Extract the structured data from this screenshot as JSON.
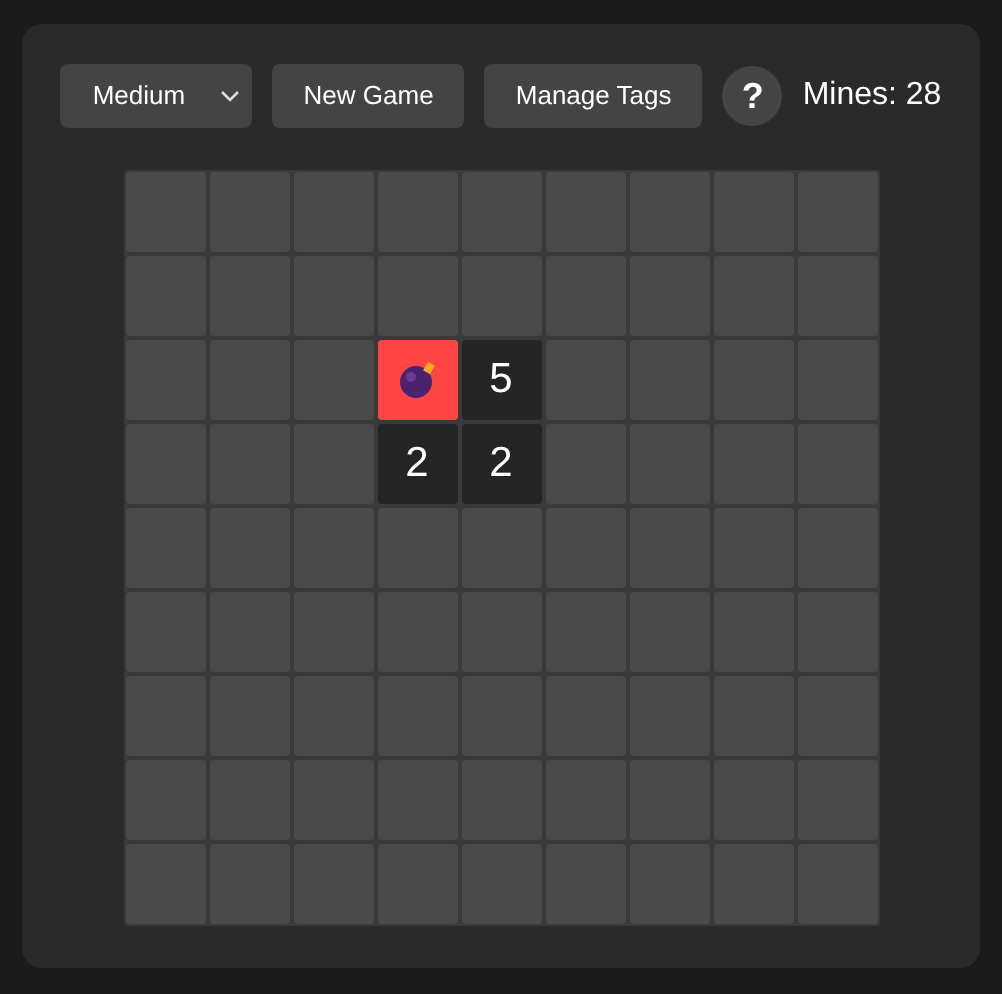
{
  "toolbar": {
    "difficulty": "Medium",
    "new_game": "New Game",
    "manage_tags": "Manage Tags",
    "help": "?",
    "mines": "Mines: 28"
  },
  "board": [
    [
      {
        "kind": "hidden"
      },
      {
        "kind": "hidden"
      },
      {
        "kind": "hidden"
      },
      {
        "kind": "hidden"
      },
      {
        "kind": "hidden"
      },
      {
        "kind": "hidden"
      },
      {
        "kind": "hidden"
      },
      {
        "kind": "hidden"
      },
      {
        "kind": "hidden"
      }
    ],
    [
      {
        "kind": "hidden"
      },
      {
        "kind": "hidden"
      },
      {
        "kind": "hidden"
      },
      {
        "kind": "hidden"
      },
      {
        "kind": "hidden"
      },
      {
        "kind": "hidden"
      },
      {
        "kind": "hidden"
      },
      {
        "kind": "hidden"
      },
      {
        "kind": "hidden"
      }
    ],
    [
      {
        "kind": "hidden"
      },
      {
        "kind": "hidden"
      },
      {
        "kind": "hidden"
      },
      {
        "kind": "mine"
      },
      {
        "kind": "number",
        "label": "5"
      },
      {
        "kind": "hidden"
      },
      {
        "kind": "hidden"
      },
      {
        "kind": "hidden"
      },
      {
        "kind": "hidden"
      }
    ],
    [
      {
        "kind": "hidden"
      },
      {
        "kind": "hidden"
      },
      {
        "kind": "hidden"
      },
      {
        "kind": "number",
        "label": "2"
      },
      {
        "kind": "number",
        "label": "2"
      },
      {
        "kind": "hidden"
      },
      {
        "kind": "hidden"
      },
      {
        "kind": "hidden"
      },
      {
        "kind": "hidden"
      }
    ],
    [
      {
        "kind": "hidden"
      },
      {
        "kind": "hidden"
      },
      {
        "kind": "hidden"
      },
      {
        "kind": "hidden"
      },
      {
        "kind": "hidden"
      },
      {
        "kind": "hidden"
      },
      {
        "kind": "hidden"
      },
      {
        "kind": "hidden"
      },
      {
        "kind": "hidden"
      }
    ],
    [
      {
        "kind": "hidden"
      },
      {
        "kind": "hidden"
      },
      {
        "kind": "hidden"
      },
      {
        "kind": "hidden"
      },
      {
        "kind": "hidden"
      },
      {
        "kind": "hidden"
      },
      {
        "kind": "hidden"
      },
      {
        "kind": "hidden"
      },
      {
        "kind": "hidden"
      }
    ],
    [
      {
        "kind": "hidden"
      },
      {
        "kind": "hidden"
      },
      {
        "kind": "hidden"
      },
      {
        "kind": "hidden"
      },
      {
        "kind": "hidden"
      },
      {
        "kind": "hidden"
      },
      {
        "kind": "hidden"
      },
      {
        "kind": "hidden"
      },
      {
        "kind": "hidden"
      }
    ],
    [
      {
        "kind": "hidden"
      },
      {
        "kind": "hidden"
      },
      {
        "kind": "hidden"
      },
      {
        "kind": "hidden"
      },
      {
        "kind": "hidden"
      },
      {
        "kind": "hidden"
      },
      {
        "kind": "hidden"
      },
      {
        "kind": "hidden"
      },
      {
        "kind": "hidden"
      }
    ],
    [
      {
        "kind": "hidden"
      },
      {
        "kind": "hidden"
      },
      {
        "kind": "hidden"
      },
      {
        "kind": "hidden"
      },
      {
        "kind": "hidden"
      },
      {
        "kind": "hidden"
      },
      {
        "kind": "hidden"
      },
      {
        "kind": "hidden"
      },
      {
        "kind": "hidden"
      }
    ]
  ]
}
